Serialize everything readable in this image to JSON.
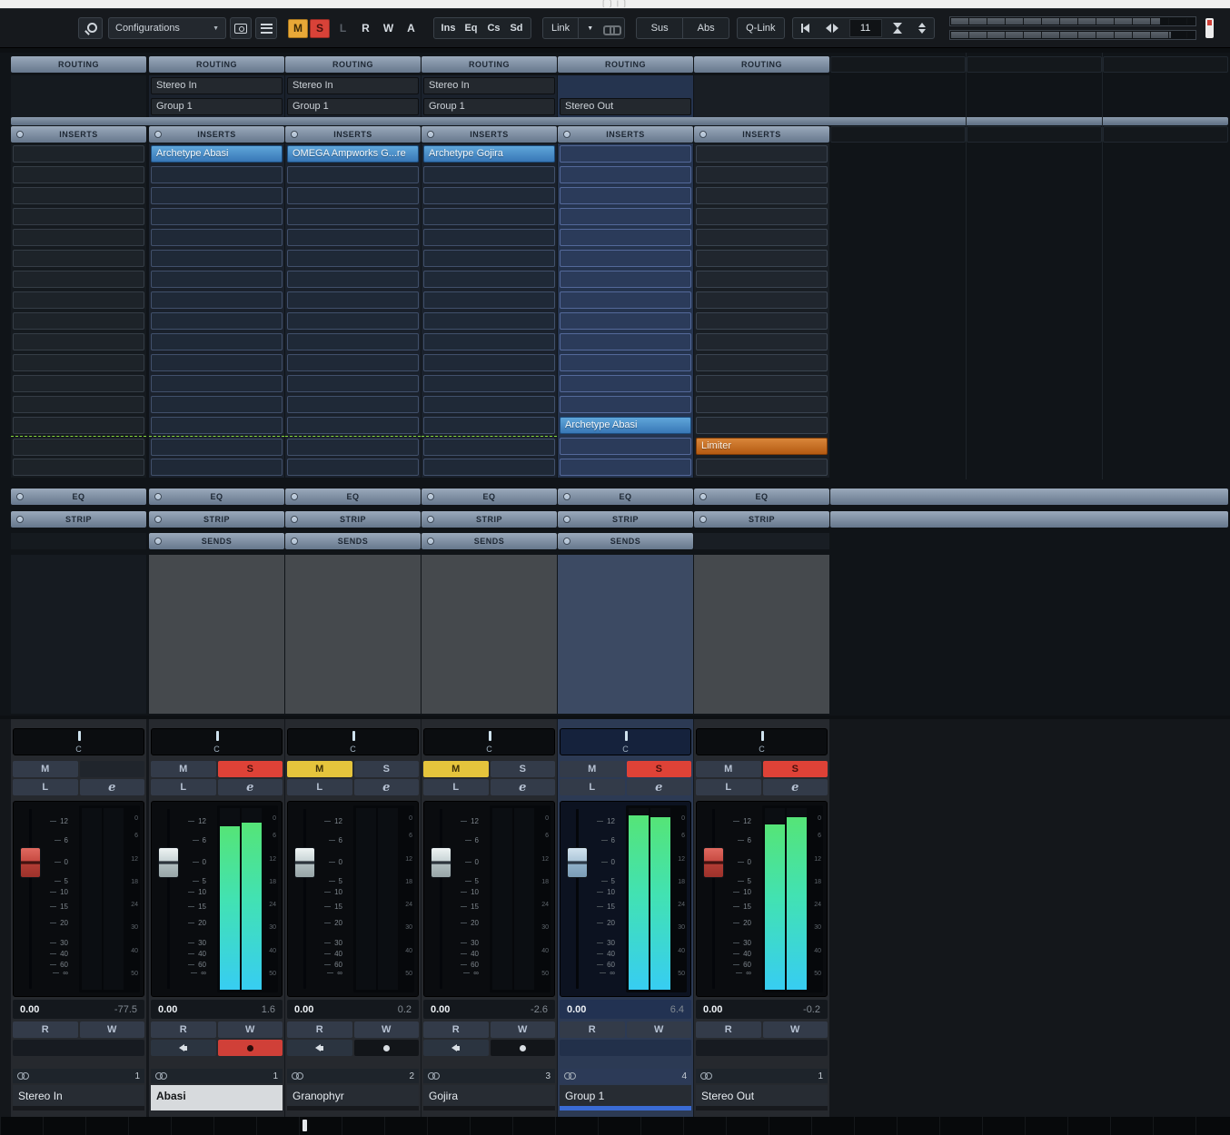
{
  "titlebar": {
    "text": "[ ]  |  ]"
  },
  "toolbar": {
    "configurations": "Configurations",
    "global_mute": "M",
    "global_solo": "S",
    "l": "L",
    "r": "R",
    "w": "W",
    "a": "A",
    "bypass": [
      "Ins",
      "Eq",
      "Cs",
      "Sd"
    ],
    "link": "Link",
    "sus": "Sus",
    "abs": "Abs",
    "qlink": "Q-Link",
    "counter": "11"
  },
  "rack": {
    "routing_label": "ROUTING",
    "inserts_label": "INSERTS",
    "eq_label": "EQ",
    "strip_label": "STRIP",
    "sends_label": "SENDS",
    "insert_slot_count": 16
  },
  "strip_labels": {
    "mute": "M",
    "solo": "S",
    "listen": "L",
    "edit": "e",
    "read": "R",
    "write": "W"
  },
  "fader_scale": [
    "12",
    "6",
    "0",
    "5",
    "10",
    "15",
    "20",
    "30",
    "40",
    "60",
    "∞"
  ],
  "meter_scale": [
    "0",
    "6",
    "12",
    "18",
    "24",
    "30",
    "40",
    "50"
  ],
  "colors": {
    "insert_active": "#3f86c4",
    "insert_limiter": "#c06018",
    "mute_on": "#e5c43c",
    "solo_on": "#de4237",
    "meter_top": "#55e477",
    "meter_bottom": "#37cdf2",
    "selected_name_bg": "#d7dadd",
    "group_channel_color": "#3a6bd4"
  },
  "channels": [
    {
      "name": "Stereo In",
      "number": "1",
      "pan": "C",
      "fader_db": "0.00",
      "peak_db": "-77.5",
      "routing": [
        "",
        ""
      ],
      "inserts": {},
      "tint": "in",
      "mute_on": false,
      "solo_on": false,
      "has_solo": false,
      "has_sends": false,
      "meter_l": 0,
      "meter_r": 0,
      "fader_color": "red",
      "monitor_row": false,
      "record_on": false,
      "selected": false,
      "color_strip": ""
    },
    {
      "name": "Abasi",
      "number": "1",
      "pan": "C",
      "fader_db": "0.00",
      "peak_db": "1.6",
      "routing": [
        "Stereo In",
        "Group 1"
      ],
      "inserts": {
        "0": {
          "label": "Archetype Abasi",
          "style": "active"
        }
      },
      "tint": "au",
      "mute_on": false,
      "solo_on": true,
      "has_solo": true,
      "has_sends": true,
      "meter_l": 90,
      "meter_r": 92,
      "fader_color": "light",
      "monitor_row": true,
      "record_on": true,
      "selected": true,
      "color_strip": "#d7dadd"
    },
    {
      "name": "Granophyr",
      "number": "2",
      "pan": "C",
      "fader_db": "0.00",
      "peak_db": "0.2",
      "routing": [
        "Stereo In",
        "Group 1"
      ],
      "inserts": {
        "0": {
          "label": "OMEGA Ampworks G...re",
          "style": "active"
        }
      },
      "tint": "au",
      "mute_on": true,
      "solo_on": false,
      "has_solo": true,
      "has_sends": true,
      "meter_l": 0,
      "meter_r": 0,
      "fader_color": "light",
      "monitor_row": true,
      "record_on": false,
      "selected": false,
      "color_strip": ""
    },
    {
      "name": "Gojira",
      "number": "3",
      "pan": "C",
      "fader_db": "0.00",
      "peak_db": "-2.6",
      "routing": [
        "Stereo In",
        "Group 1"
      ],
      "inserts": {
        "0": {
          "label": "Archetype Gojira",
          "style": "active"
        }
      },
      "tint": "au",
      "mute_on": true,
      "solo_on": false,
      "has_solo": true,
      "has_sends": true,
      "meter_l": 0,
      "meter_r": 0,
      "fader_color": "light",
      "monitor_row": true,
      "record_on": false,
      "selected": false,
      "color_strip": ""
    },
    {
      "name": "Group 1",
      "number": "4",
      "pan": "C",
      "fader_db": "0.00",
      "peak_db": "6.4",
      "routing": [
        "",
        "Stereo Out"
      ],
      "inserts": {
        "13": {
          "label": "Archetype Abasi",
          "style": "active"
        }
      },
      "tint": "gs",
      "mute_on": false,
      "solo_on": true,
      "has_solo": true,
      "has_sends": true,
      "meter_l": 96,
      "meter_r": 95,
      "fader_color": "blue",
      "monitor_row": false,
      "record_on": false,
      "selected": false,
      "color_strip": "#3a6bd4"
    },
    {
      "name": "Stereo Out",
      "number": "1",
      "pan": "C",
      "fader_db": "0.00",
      "peak_db": "-0.2",
      "routing": [
        "",
        ""
      ],
      "inserts": {
        "14": {
          "label": "Limiter",
          "style": "limiter"
        }
      },
      "tint": "out",
      "mute_on": false,
      "solo_on": true,
      "has_solo": true,
      "has_sends": false,
      "meter_l": 91,
      "meter_r": 95,
      "fader_color": "red",
      "monitor_row": false,
      "record_on": false,
      "selected": false,
      "color_strip": ""
    }
  ]
}
